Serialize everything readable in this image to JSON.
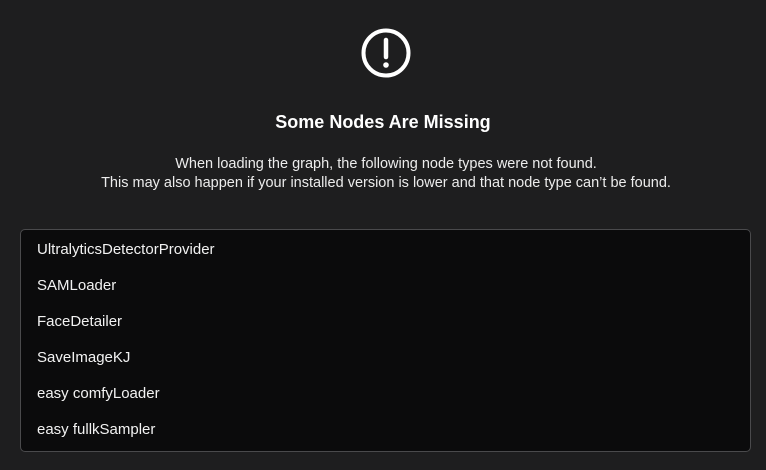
{
  "dialog": {
    "icon": "exclamation-circle-icon",
    "title": "Some Nodes Are Missing",
    "message_lines": [
      "When loading the graph, the following node types were not found.",
      "This may also happen if your installed version is lower and that node type can’t be found."
    ],
    "missing_nodes": [
      "UltralyticsDetectorProvider",
      "SAMLoader",
      "FaceDetailer",
      "SaveImageKJ",
      "easy comfyLoader",
      "easy fullkSampler"
    ]
  },
  "colors": {
    "background": "#1e1e1f",
    "list_background": "#0b0b0c",
    "list_border": "#4a4a4c",
    "text": "#ffffff"
  }
}
